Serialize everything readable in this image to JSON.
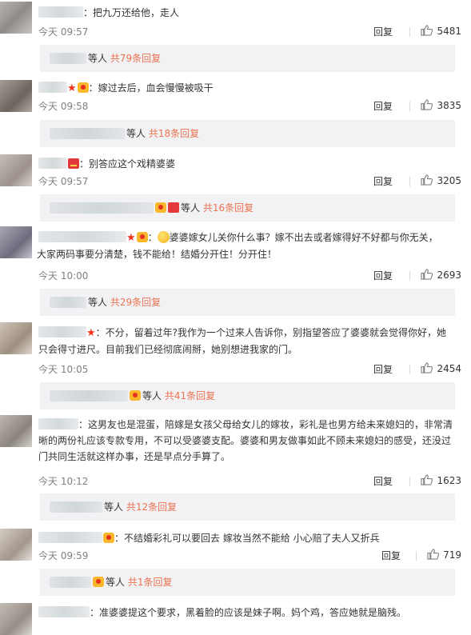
{
  "comments": [
    {
      "text": "：把九万还给他，走人",
      "time": "今天 09:57",
      "reply": "回复",
      "likes": "5481",
      "sub": {
        "prefix": "等人",
        "count": "共79条回复"
      }
    },
    {
      "text": "：嫁过去后，血会慢慢被吸干",
      "time": "今天 09:58",
      "reply": "回复",
      "likes": "3835",
      "sub": {
        "prefix": "等人",
        "count": "共18条回复"
      }
    },
    {
      "text": "：别答应这个戏精婆婆",
      "time": "今天 09:57",
      "reply": "回复",
      "likes": "3205",
      "sub": {
        "prefix": "等人",
        "count": "共16条回复"
      }
    },
    {
      "text_line1": "婆婆嫁女儿关你什么事？嫁不出去或者嫁得好不好都与你无关，",
      "text_line2": "大家两码事要分清楚，钱不能给！结婚分开住！分开住！",
      "time": "今天 10:00",
      "reply": "回复",
      "likes": "2693",
      "sub": {
        "prefix": "等人",
        "count": "共29条回复"
      }
    },
    {
      "text_line1": "：不分，留着过年?我作为一个过来人告诉你，别指望答应了婆婆就会觉得你好，她",
      "text_line2": "只会得寸进尺。目前我们已经彻底闹掰，她别想进我家的门。",
      "time": "今天 10:05",
      "reply": "回复",
      "likes": "2454",
      "sub": {
        "prefix": "等人",
        "count": "共41条回复"
      }
    },
    {
      "text_line1": "：这男友也是混蛋，陪嫁是女孩父母给女儿的嫁妆，彩礼是也男方给未来媳妇的，非常清",
      "text_line2": "晰的两份礼应该专款专用，不可以受婆婆支配。婆婆和男友做事如此不顾未来媳妇的感受，还没过",
      "text_line3": "门共同生活就这样办事，还是早点分手算了。",
      "time": "今天 10:12",
      "reply": "回复",
      "likes": "1623",
      "sub": {
        "prefix": "等人",
        "count": "共12条回复"
      }
    },
    {
      "text": "：不结婚彩礼可以要回去 嫁妆当然不能给 小心赔了夫人又折兵",
      "time": "今天 09:59",
      "reply": "回复",
      "likes": "719",
      "sub": {
        "prefix": "等人",
        "count": "共1条回复"
      }
    },
    {
      "text": "：准婆婆提这个要求，黑着脸的应该是妹子啊。妈个鸡，答应她就是脑残。"
    }
  ],
  "colors": {
    "link": "#eb7350",
    "meta": "#808080",
    "subbg": "#f2f2f5"
  },
  "icons": [
    "star-badge-icon",
    "vip-badge-icon",
    "red-envelope-badge-icon",
    "emoji-icon",
    "like-thumb-icon"
  ]
}
